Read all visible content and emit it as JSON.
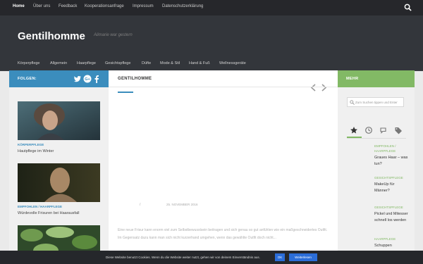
{
  "topnav": {
    "items": [
      "Home",
      "Über uns",
      "Feedback",
      "Kooperationsanfrage",
      "Impressum",
      "Datenschutzerklärung"
    ],
    "search_icon": "search-icon"
  },
  "header": {
    "site_title": "Gentilhomme",
    "tagline": "Alimarie war gestern",
    "categories": [
      "Körperpflege",
      "Allgemein",
      "Haarpflege",
      "Gesichtspflege",
      "Düfte",
      "Mode & Stil",
      "Hand & Fuß",
      "Wellnessgeräte"
    ]
  },
  "left": {
    "heading": "FOLGEN:",
    "social_icons": [
      "twitter-icon",
      "google-plus-icon",
      "facebook-icon"
    ],
    "posts": [
      {
        "category": "KÖRPERPFLEGE",
        "title": "Hautpflege im Winter"
      },
      {
        "category": "EMPFOHLEN / HAARPFLEGE",
        "title": "Würdevolle Frisuren bei Haarausfall"
      },
      {
        "category": "",
        "title": ""
      }
    ]
  },
  "main": {
    "heading": "GENTILHOMME",
    "slash": "/",
    "date": "25. NOVEMBER 2016",
    "excerpt": "Eine neue Frisur kann enorm viel zum Selbstbewusstsein beitragen und sich genau so gut anfühlen wie ein maßgeschneidertes Outfit. Im Gegensatz dazu kann man sich nicht kurzerhand umgehen, wenn das gewählte Outfit doch nicht..."
  },
  "right": {
    "heading": "MEHR",
    "search_placeholder": "Zum Suchen tippen und Enter",
    "tab_icons": [
      "star-icon",
      "clock-icon",
      "comments-icon",
      "tags-icon"
    ],
    "items": [
      {
        "category": "EMPFOHLEN / HAARPFLEGE",
        "title": "Graues Haar – was tun?"
      },
      {
        "category": "GESICHTSPFLEGE",
        "title": "MakeUp für Männer?"
      },
      {
        "category": "GESICHTSPFLEGE",
        "title": "Pickel und Mitesser schnell los werden"
      },
      {
        "category": "HAARPFLEGE",
        "title": "Schuppen"
      }
    ]
  },
  "cookie": {
    "text": "Diese Website benutzt Cookies. Wenn du die Website weiter nutzt, gehen wir von deinem Einverständnis aus.",
    "ok_label": "OK",
    "more_label": "Weiterlesen"
  },
  "colors": {
    "blue": "#3b8dbd",
    "green": "#82b965",
    "dark": "#26272b"
  }
}
